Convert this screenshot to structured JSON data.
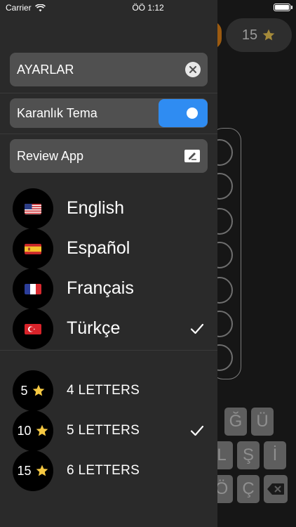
{
  "status_bar": {
    "carrier": "Carrier",
    "time": "ÖÖ 1:12"
  },
  "background": {
    "score_value": "15",
    "keyboard_rows": [
      [
        "Ğ",
        "Ü"
      ],
      [
        "L",
        "Ş",
        "İ"
      ],
      [
        "Ö",
        "Ç"
      ]
    ]
  },
  "drawer": {
    "settings": {
      "title": "AYARLAR"
    },
    "dark_theme": {
      "label": "Karanlık Tema",
      "enabled": true,
      "accent_color": "#2f8cf2"
    },
    "review": {
      "label": "Review App"
    },
    "languages": [
      {
        "label": "English",
        "flag": "us-flag",
        "selected": false
      },
      {
        "label": "Español",
        "flag": "spain-flag",
        "selected": false
      },
      {
        "label": "Français",
        "flag": "france-flag",
        "selected": false
      },
      {
        "label": "Türkçe",
        "flag": "turkey-flag",
        "selected": true
      }
    ],
    "levels": [
      {
        "stars": "5",
        "label": "4 LETTERS",
        "selected": false
      },
      {
        "stars": "10",
        "label": "5 LETTERS",
        "selected": true
      },
      {
        "stars": "15",
        "label": "6 LETTERS",
        "selected": false
      }
    ]
  }
}
